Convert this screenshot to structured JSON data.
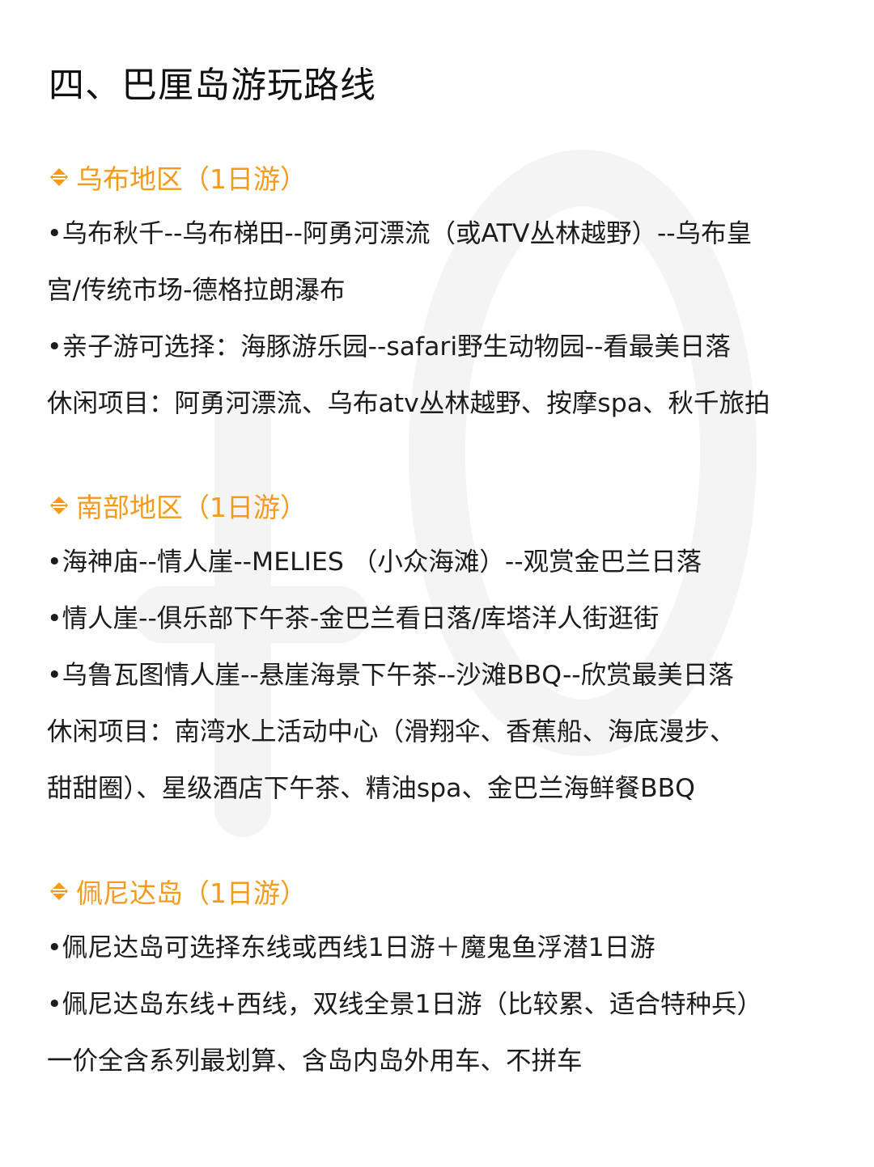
{
  "title": "四、巴厘岛游玩路线",
  "colors": {
    "accent": "#f59a1b",
    "text": "#1c1c1c",
    "watermark": "#f3f3f3"
  },
  "sections": [
    {
      "heading": "乌布地区（1日游）",
      "icon": "diamond-icon",
      "lines": [
        "•乌布秋千--乌布梯田--阿勇河漂流（或ATV丛林越野）--乌布皇",
        "宫/传统市场-德格拉朗瀑布",
        "•亲子游可选择：海豚游乐园--safari野生动物园--看最美日落",
        "休闲项目：阿勇河漂流、乌布atv丛林越野、按摩spa、秋千旅拍"
      ]
    },
    {
      "heading": "南部地区（1日游）",
      "icon": "diamond-icon",
      "lines": [
        "•海神庙--情人崖--MELIES （小众海滩）--观赏金巴兰日落",
        "•情人崖--俱乐部下午茶-金巴兰看日落/库塔洋人街逛街",
        "•乌鲁瓦图情人崖--悬崖海景下午茶--沙滩BBQ--欣赏最美日落",
        "休闲项目：南湾水上活动中心（滑翔伞、香蕉船、海底漫步、",
        "甜甜圈）、星级酒店下午茶、精油spa、金巴兰海鲜餐BBQ"
      ]
    },
    {
      "heading": "佩尼达岛（1日游）",
      "icon": "diamond-icon",
      "lines": [
        "•佩尼达岛可选择东线或西线1日游＋魔鬼鱼浮潜1日游",
        "•佩尼达岛东线+西线，双线全景1日游（比较累、适合特种兵）",
        "一价全含系列最划算、含岛内岛外用车、不拼车"
      ]
    }
  ]
}
